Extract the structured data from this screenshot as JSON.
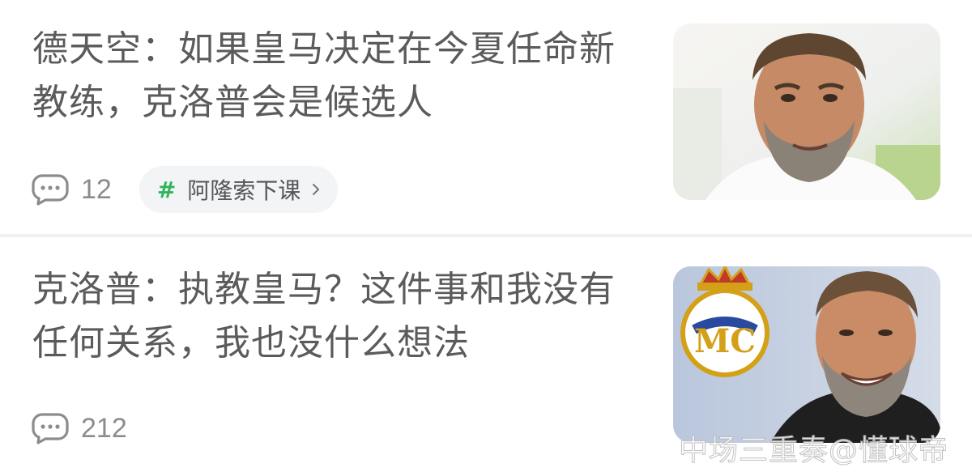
{
  "feed": {
    "articles": [
      {
        "title": "德天空：如果皇马决定在今夏任命新教练，克洛普会是候选人",
        "comment_count": "12",
        "topic_tag": "阿隆索下课",
        "thumbnail": "klopp-portrait-photo"
      },
      {
        "title": "克洛普：执教皇马？这件事和我没有任何关系，我也没什么想法",
        "comment_count": "212",
        "thumbnail": "klopp-with-real-madrid-crest-photo"
      }
    ]
  },
  "watermark": "中场三重奏@懂球帝",
  "colors": {
    "title_text": "#5b5b5b",
    "meta_text": "#8c8c8c",
    "tag_background": "#f2f4f6",
    "hash_green": "#2fb45a",
    "divider": "#f0f1f3"
  },
  "icons": [
    "comment-icon",
    "hash-icon",
    "chevron-right-icon"
  ]
}
